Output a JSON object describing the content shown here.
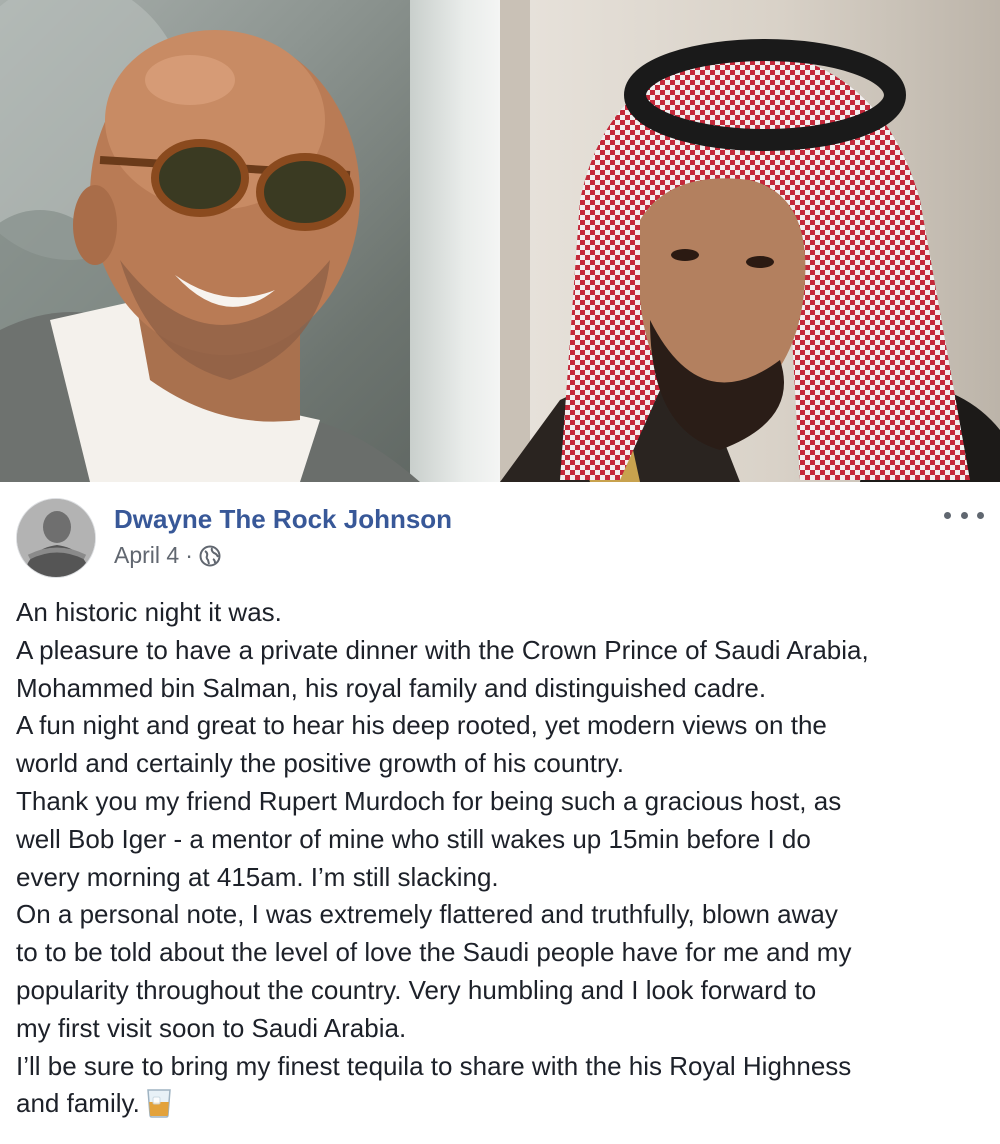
{
  "photo": {
    "left_subject": "smiling man in sunglasses",
    "right_subject": "man in red and white ghutra"
  },
  "post": {
    "author": "Dwayne The Rock Johnson",
    "date": "April 4",
    "separator": "·",
    "privacy_icon": "globe-icon",
    "menu_icon": "more-options-icon",
    "lines": [
      "An historic night it was.",
      "A pleasure to have a private dinner with the Crown Prince of Saudi Arabia,",
      "Mohammed bin Salman, his royal family and distinguished cadre.",
      "A fun night and great to hear his deep rooted, yet modern views on the",
      "world and certainly the positive growth of his country.",
      "Thank you my friend Rupert Murdoch for being such a gracious host, as",
      "well Bob Iger - a mentor of mine who still wakes up 15min before I do",
      "every morning at 415am. I’m still slacking.",
      "On a personal note, I was extremely flattered and truthfully, blown away",
      "to to be told about the level of love the Saudi people have for me and my",
      "popularity throughout the country. Very humbling and I look forward to",
      "my first visit soon to Saudi Arabia.",
      "I’ll be sure to bring my finest tequila to share with the his Royal Highness",
      "and family."
    ],
    "end_emoji": "tumbler-glass-icon"
  },
  "colors": {
    "author_link": "#385898",
    "meta_text": "#616770",
    "body_text": "#1d2129"
  }
}
